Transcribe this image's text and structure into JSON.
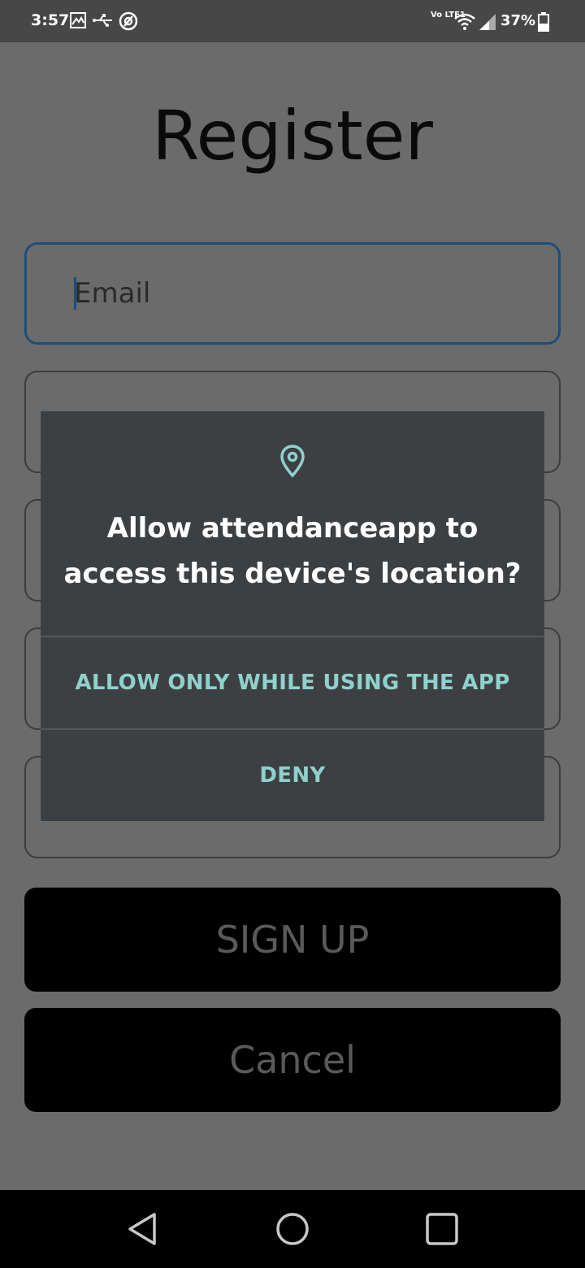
{
  "status_bar": {
    "time": "3:57",
    "network_label": "Vo LTE1",
    "battery": "37%"
  },
  "page": {
    "title": "Register",
    "email_placeholder": "Email",
    "signup_label": "SIGN UP",
    "cancel_label": "Cancel"
  },
  "dialog": {
    "icon": "location-pin-icon",
    "title_line1": "Allow attendanceapp to",
    "title_line2": "access this device's location?",
    "allow_label": "ALLOW ONLY WHILE USING THE APP",
    "deny_label": "DENY"
  },
  "nav_bar": {
    "back": "back-icon",
    "home": "home-icon",
    "recents": "recents-icon"
  },
  "colors": {
    "overlay_background": "#6b6b6b",
    "dialog_background": "#3d4043",
    "dialog_accent": "#8fd1cd",
    "focused_border": "#1b4e7c"
  }
}
